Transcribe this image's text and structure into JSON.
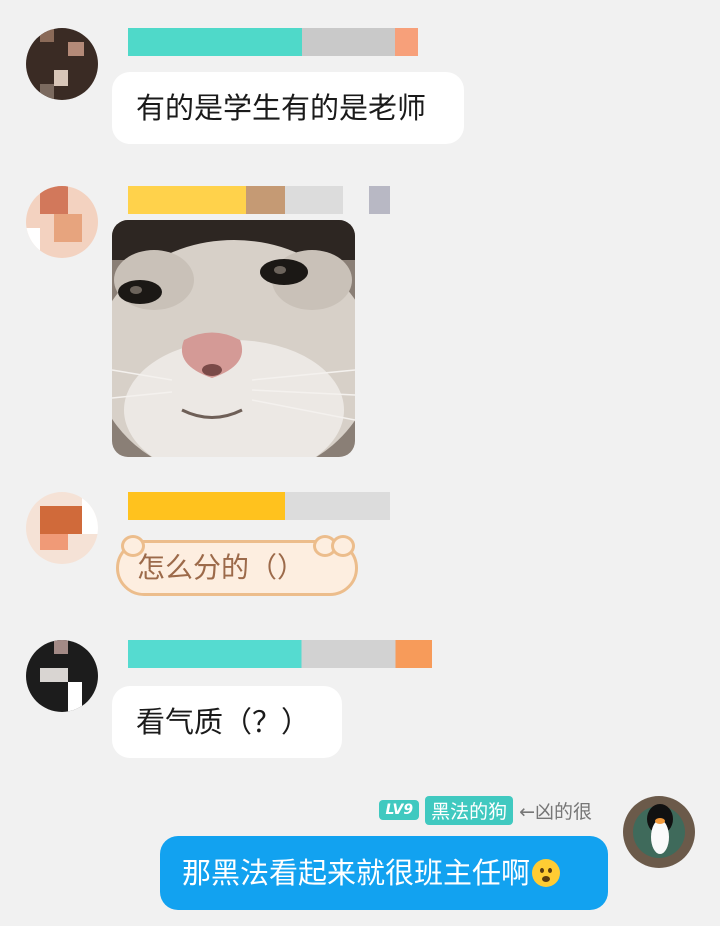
{
  "messages": [
    {
      "text": "有的是学生有的是老师"
    },
    {
      "type": "image",
      "alt": ""
    },
    {
      "text": "怎么分的（）"
    },
    {
      "text": "看气质（？）"
    }
  ],
  "self": {
    "level": "LV9",
    "title": "黑法的狗",
    "remark": "←凶的很",
    "message": "那黑法看起来就很班主任啊"
  },
  "colors": {
    "background": "#f1f1f1",
    "self_bubble": "#12a2f0",
    "level_badge": "#40c9c0"
  }
}
